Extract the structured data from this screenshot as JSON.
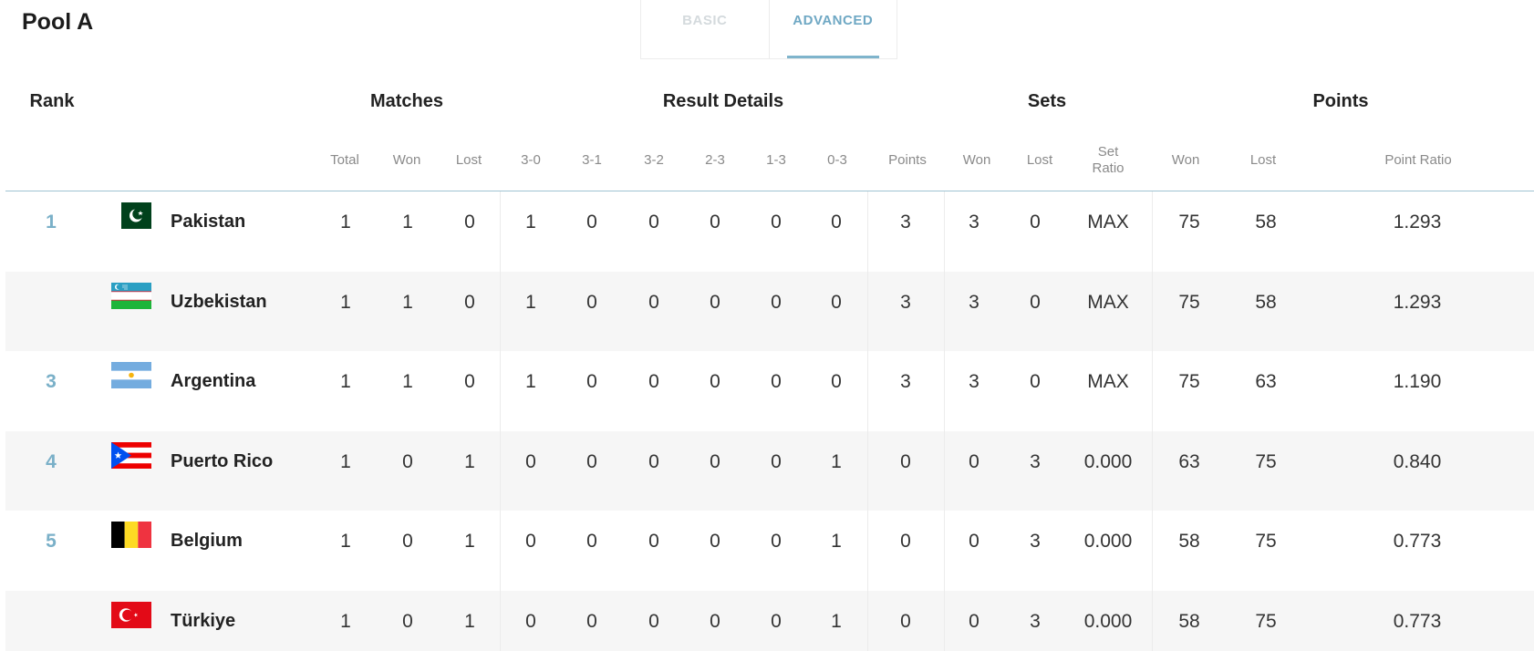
{
  "pool_title": "Pool A",
  "tabs": [
    {
      "label": "BASIC",
      "active": false
    },
    {
      "label": "ADVANCED",
      "active": true
    }
  ],
  "group_headers": {
    "rank": "Rank",
    "matches": "Matches",
    "result_details": "Result Details",
    "sets": "Sets",
    "points": "Points"
  },
  "columns": {
    "total": "Total",
    "won": "Won",
    "lost": "Lost",
    "r30": "3-0",
    "r31": "3-1",
    "r32": "3-2",
    "r23": "2-3",
    "r13": "1-3",
    "r03": "0-3",
    "points": "Points",
    "sets_won": "Won",
    "sets_lost": "Lost",
    "set_ratio_1": "Set",
    "set_ratio_2": "Ratio",
    "points_won": "Won",
    "points_lost": "Lost",
    "point_ratio": "Point Ratio"
  },
  "accent_color": "#7ab0c8",
  "rows": [
    {
      "rank": "1",
      "flag": "pakistan-flag-icon",
      "country": "Pakistan",
      "total": "1",
      "won": "1",
      "lost": "0",
      "r30": "1",
      "r31": "0",
      "r32": "0",
      "r23": "0",
      "r13": "0",
      "r03": "0",
      "points": "3",
      "sets_won": "3",
      "sets_lost": "0",
      "set_ratio": "MAX",
      "points_won": "75",
      "points_lost": "58",
      "point_ratio": "1.293"
    },
    {
      "rank": "",
      "flag": "uzbekistan-flag-icon",
      "country": "Uzbekistan",
      "total": "1",
      "won": "1",
      "lost": "0",
      "r30": "1",
      "r31": "0",
      "r32": "0",
      "r23": "0",
      "r13": "0",
      "r03": "0",
      "points": "3",
      "sets_won": "3",
      "sets_lost": "0",
      "set_ratio": "MAX",
      "points_won": "75",
      "points_lost": "58",
      "point_ratio": "1.293"
    },
    {
      "rank": "3",
      "flag": "argentina-flag-icon",
      "country": "Argentina",
      "total": "1",
      "won": "1",
      "lost": "0",
      "r30": "1",
      "r31": "0",
      "r32": "0",
      "r23": "0",
      "r13": "0",
      "r03": "0",
      "points": "3",
      "sets_won": "3",
      "sets_lost": "0",
      "set_ratio": "MAX",
      "points_won": "75",
      "points_lost": "63",
      "point_ratio": "1.190"
    },
    {
      "rank": "4",
      "flag": "puerto-rico-flag-icon",
      "country": "Puerto Rico",
      "total": "1",
      "won": "0",
      "lost": "1",
      "r30": "0",
      "r31": "0",
      "r32": "0",
      "r23": "0",
      "r13": "0",
      "r03": "1",
      "points": "0",
      "sets_won": "0",
      "sets_lost": "3",
      "set_ratio": "0.000",
      "points_won": "63",
      "points_lost": "75",
      "point_ratio": "0.840"
    },
    {
      "rank": "5",
      "flag": "belgium-flag-icon",
      "country": "Belgium",
      "total": "1",
      "won": "0",
      "lost": "1",
      "r30": "0",
      "r31": "0",
      "r32": "0",
      "r23": "0",
      "r13": "0",
      "r03": "1",
      "points": "0",
      "sets_won": "0",
      "sets_lost": "3",
      "set_ratio": "0.000",
      "points_won": "58",
      "points_lost": "75",
      "point_ratio": "0.773"
    },
    {
      "rank": "",
      "flag": "turkiye-flag-icon",
      "country": "Türkiye",
      "total": "1",
      "won": "0",
      "lost": "1",
      "r30": "0",
      "r31": "0",
      "r32": "0",
      "r23": "0",
      "r13": "0",
      "r03": "1",
      "points": "0",
      "sets_won": "0",
      "sets_lost": "3",
      "set_ratio": "0.000",
      "points_won": "58",
      "points_lost": "75",
      "point_ratio": "0.773"
    }
  ]
}
